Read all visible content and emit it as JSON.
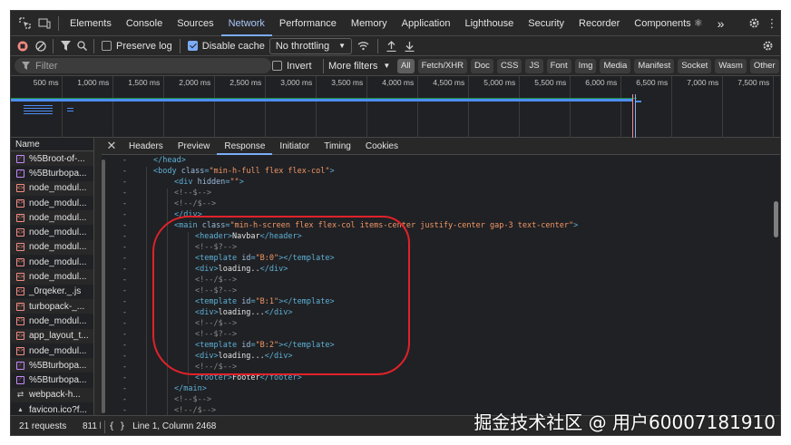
{
  "main_tabs": [
    "Elements",
    "Console",
    "Sources",
    "Network",
    "Performance",
    "Memory",
    "Application",
    "Lighthouse",
    "Security",
    "Recorder",
    "Components ⚛"
  ],
  "more_tabs": "»",
  "toolbar": {
    "preserve_log": "Preserve log",
    "disable_cache": "Disable cache",
    "throttling": "No throttling"
  },
  "filter": {
    "placeholder": "Filter",
    "invert": "Invert",
    "more_filters": "More filters",
    "chips": [
      "All",
      "Fetch/XHR",
      "Doc",
      "CSS",
      "JS",
      "Font",
      "Img",
      "Media",
      "Manifest",
      "Socket",
      "Wasm",
      "Other"
    ]
  },
  "timeline_ticks": [
    "500 ms",
    "1,000 ms",
    "1,500 ms",
    "2,000 ms",
    "2,500 ms",
    "3,000 ms",
    "3,500 ms",
    "4,000 ms",
    "4,500 ms",
    "5,000 ms",
    "5,500 ms",
    "6,000 ms",
    "6,500 ms",
    "7,000 ms",
    "7,500 ms"
  ],
  "requests": {
    "header": "Name",
    "items": [
      {
        "name": "%5Broot-of-...",
        "type": "doc"
      },
      {
        "name": "%5Bturbopa...",
        "type": "doc"
      },
      {
        "name": "node_modul...",
        "type": "script"
      },
      {
        "name": "node_modul...",
        "type": "script"
      },
      {
        "name": "node_modul...",
        "type": "script"
      },
      {
        "name": "node_modul...",
        "type": "script"
      },
      {
        "name": "node_modul...",
        "type": "script"
      },
      {
        "name": "node_modul...",
        "type": "script"
      },
      {
        "name": "node_modul...",
        "type": "script"
      },
      {
        "name": "_0rqeker._.js",
        "type": "script"
      },
      {
        "name": "turbopack-_...",
        "type": "script"
      },
      {
        "name": "node_modul...",
        "type": "script"
      },
      {
        "name": "app_layout_t...",
        "type": "script"
      },
      {
        "name": "node_modul...",
        "type": "script"
      },
      {
        "name": "%5Bturbopa...",
        "type": "doc"
      },
      {
        "name": "%5Bturbopa...",
        "type": "doc"
      },
      {
        "name": "webpack-h...",
        "type": "ws"
      },
      {
        "name": "favicon.ico?f...",
        "type": "fav"
      }
    ]
  },
  "detail_tabs": [
    "Headers",
    "Preview",
    "Response",
    "Initiator",
    "Timing",
    "Cookies"
  ],
  "code_lines": [
    {
      "indent": 2,
      "parts": [
        [
          "tag",
          "</head>"
        ]
      ]
    },
    {
      "indent": 2,
      "parts": [
        [
          "tag",
          "<body "
        ],
        [
          "an",
          "class"
        ],
        [
          "tag",
          "="
        ],
        [
          "av",
          "\"min-h-full flex flex-col\""
        ],
        [
          "tag",
          ">"
        ]
      ]
    },
    {
      "indent": 4,
      "parts": [
        [
          "tag",
          "<div "
        ],
        [
          "an",
          "hidden"
        ],
        [
          "tag",
          "="
        ],
        [
          "av",
          "\"\""
        ],
        [
          "tag",
          ">"
        ]
      ]
    },
    {
      "indent": 4,
      "parts": [
        [
          "cm",
          "<!--$-->"
        ]
      ]
    },
    {
      "indent": 4,
      "parts": [
        [
          "cm",
          "<!--/$-->"
        ]
      ]
    },
    {
      "indent": 4,
      "parts": [
        [
          "tag",
          "</div>"
        ]
      ]
    },
    {
      "indent": 4,
      "parts": [
        [
          "tag",
          "<main "
        ],
        [
          "an",
          "class"
        ],
        [
          "tag",
          "="
        ],
        [
          "av",
          "\"min-h-screen flex flex-col items-center justify-center gap-3 text-center\""
        ],
        [
          "tag",
          ">"
        ]
      ]
    },
    {
      "indent": 6,
      "parts": [
        [
          "tag",
          "<header>"
        ],
        [
          "tx",
          "Navbar"
        ],
        [
          "tag",
          "</header>"
        ]
      ]
    },
    {
      "indent": 6,
      "parts": [
        [
          "cm",
          "<!--$?-->"
        ]
      ]
    },
    {
      "indent": 6,
      "parts": [
        [
          "tag",
          "<template "
        ],
        [
          "an",
          "id"
        ],
        [
          "tag",
          "="
        ],
        [
          "av",
          "\"B:0\""
        ],
        [
          "tag",
          "></template>"
        ]
      ]
    },
    {
      "indent": 6,
      "parts": [
        [
          "tag",
          "<div>"
        ],
        [
          "tx",
          "loading.."
        ],
        [
          "tag",
          "</div>"
        ]
      ]
    },
    {
      "indent": 6,
      "parts": [
        [
          "cm",
          "<!--/$-->"
        ]
      ]
    },
    {
      "indent": 6,
      "parts": [
        [
          "cm",
          "<!--$?-->"
        ]
      ]
    },
    {
      "indent": 6,
      "parts": [
        [
          "tag",
          "<template "
        ],
        [
          "an",
          "id"
        ],
        [
          "tag",
          "="
        ],
        [
          "av",
          "\"B:1\""
        ],
        [
          "tag",
          "></template>"
        ]
      ]
    },
    {
      "indent": 6,
      "parts": [
        [
          "tag",
          "<div>"
        ],
        [
          "tx",
          "loading..."
        ],
        [
          "tag",
          "</div>"
        ]
      ]
    },
    {
      "indent": 6,
      "parts": [
        [
          "cm",
          "<!--/$-->"
        ]
      ]
    },
    {
      "indent": 6,
      "parts": [
        [
          "cm",
          "<!--$?-->"
        ]
      ]
    },
    {
      "indent": 6,
      "parts": [
        [
          "tag",
          "<template "
        ],
        [
          "an",
          "id"
        ],
        [
          "tag",
          "="
        ],
        [
          "av",
          "\"B:2\""
        ],
        [
          "tag",
          "></template>"
        ]
      ]
    },
    {
      "indent": 6,
      "parts": [
        [
          "tag",
          "<div>"
        ],
        [
          "tx",
          "loading..."
        ],
        [
          "tag",
          "</div>"
        ]
      ]
    },
    {
      "indent": 6,
      "parts": [
        [
          "cm",
          "<!--/$-->"
        ]
      ]
    },
    {
      "indent": 6,
      "parts": [
        [
          "tag",
          "<footer>"
        ],
        [
          "tx",
          "Footer"
        ],
        [
          "tag",
          "</footer>"
        ]
      ]
    },
    {
      "indent": 4,
      "parts": [
        [
          "tag",
          "</main>"
        ]
      ]
    },
    {
      "indent": 4,
      "parts": [
        [
          "cm",
          "<!--$-->"
        ]
      ]
    },
    {
      "indent": 4,
      "parts": [
        [
          "cm",
          "<!--/$-->"
        ]
      ]
    }
  ],
  "gutter_mark": "-",
  "status": {
    "requests": "21 requests",
    "transferred": "811 k",
    "position": "Line 1, Column 2468"
  },
  "watermark": "掘金技术社区 @ 用户60007181910",
  "colors": {
    "accent": "#7cacf8",
    "record": "#f28b82",
    "annotation": "#e0222a"
  }
}
